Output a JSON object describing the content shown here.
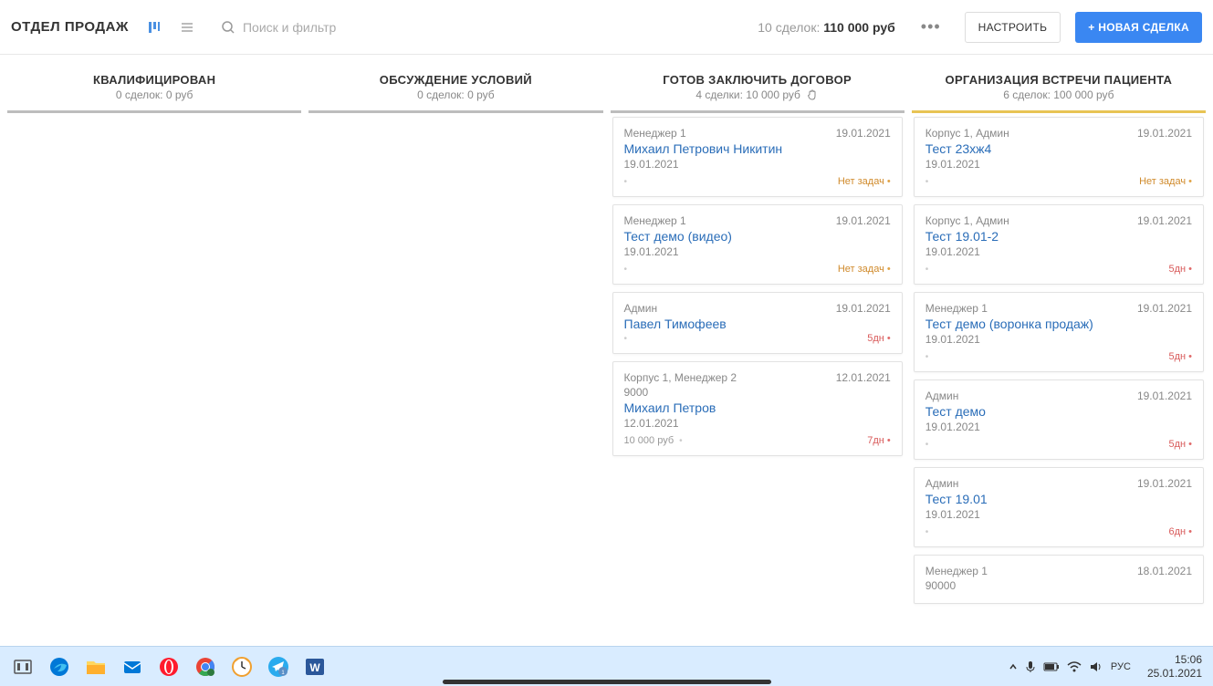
{
  "header": {
    "title": "ОТДЕЛ ПРОДАЖ",
    "search_placeholder": "Поиск и фильтр",
    "summary_prefix": "10 сделок:",
    "summary_amount": "110 000 руб",
    "configure": "НАСТРОИТЬ",
    "new_deal": "+ НОВАЯ СДЕЛКА"
  },
  "columns": [
    {
      "title": "КВАЛИФИЦИРОВАН",
      "sub": "0 сделок: 0 руб",
      "bar": "#bdbdbd",
      "cards": []
    },
    {
      "title": "ОБСУЖДЕНИЕ УСЛОВИЙ",
      "sub": "0 сделок: 0 руб",
      "bar": "#bdbdbd",
      "cards": []
    },
    {
      "title": "ГОТОВ ЗАКЛЮЧИТЬ ДОГОВОР",
      "sub": "4 сделки: 10 000 руб",
      "bar": "#bdbdbd",
      "hand": true,
      "cards": [
        {
          "mgr": "Менеджер 1",
          "top_date": "19.01.2021",
          "name": "Михаил Петрович Никитин",
          "date": "19.01.2021",
          "tag": "Нет задач",
          "tag_cls": "tag-warn"
        },
        {
          "mgr": "Менеджер 1",
          "top_date": "19.01.2021",
          "name": "Тест демо (видео)",
          "date": "19.01.2021",
          "tag": "Нет задач",
          "tag_cls": "tag-warn"
        },
        {
          "mgr": "Админ",
          "top_date": "19.01.2021",
          "name": "Павел Тимофеев",
          "tag": "5дн",
          "tag_cls": "tag-red"
        },
        {
          "mgr": "Корпус 1, Менеджер 2",
          "top_date": "12.01.2021",
          "extra": "9000",
          "name": "Михаил Петров",
          "date": "12.01.2021",
          "price": "10 000 руб",
          "tag": "7дн",
          "tag_cls": "tag-red"
        }
      ]
    },
    {
      "title": "ОРГАНИЗАЦИЯ ВСТРЕЧИ ПАЦИЕНТА",
      "sub": "6 сделок: 100 000 руб",
      "bar": "#e8c454",
      "cards": [
        {
          "mgr": "Корпус 1, Админ",
          "top_date": "19.01.2021",
          "name": "Тест 23хж4",
          "date": "19.01.2021",
          "tag": "Нет задач",
          "tag_cls": "tag-warn"
        },
        {
          "mgr": "Корпус 1, Админ",
          "top_date": "19.01.2021",
          "name": "Тест 19.01-2",
          "date": "19.01.2021",
          "tag": "5дн",
          "tag_cls": "tag-red"
        },
        {
          "mgr": "Менеджер 1",
          "top_date": "19.01.2021",
          "name": "Тест демо (воронка продаж)",
          "date": "19.01.2021",
          "tag": "5дн",
          "tag_cls": "tag-red"
        },
        {
          "mgr": "Админ",
          "top_date": "19.01.2021",
          "name": "Тест демо",
          "date": "19.01.2021",
          "tag": "5дн",
          "tag_cls": "tag-red"
        },
        {
          "mgr": "Админ",
          "top_date": "19.01.2021",
          "name": "Тест 19.01",
          "date": "19.01.2021",
          "tag": "6дн",
          "tag_cls": "tag-red"
        },
        {
          "mgr": "Менеджер 1",
          "top_date": "18.01.2021",
          "extra": "90000"
        }
      ]
    }
  ],
  "taskbar": {
    "lang": "РУС",
    "time": "15:06",
    "date": "25.01.2021"
  }
}
